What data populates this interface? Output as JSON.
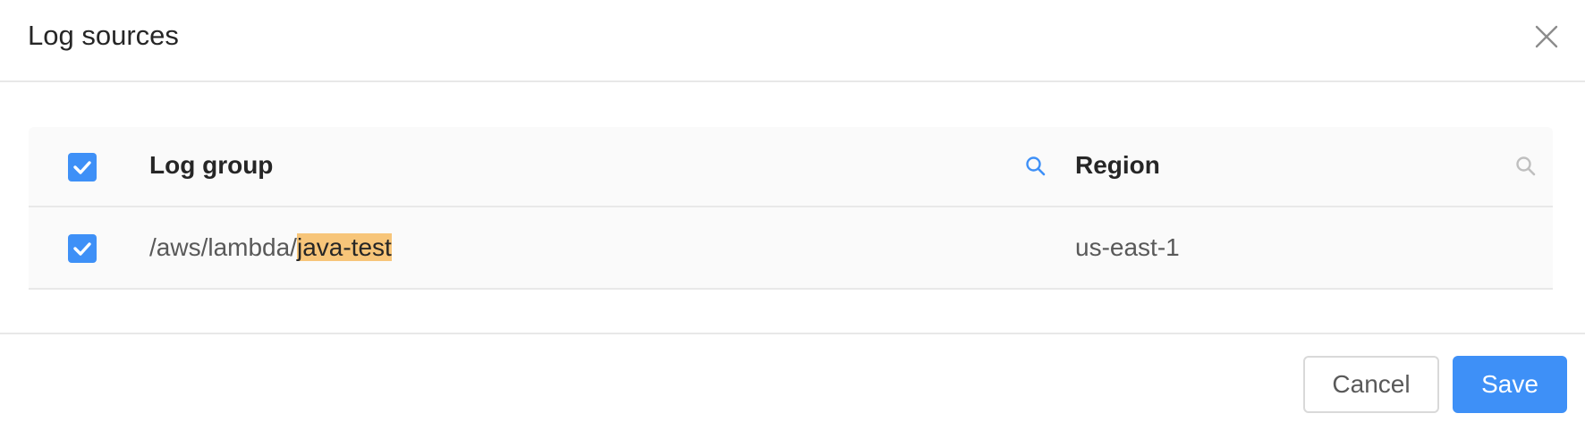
{
  "modal": {
    "title": "Log sources"
  },
  "table": {
    "columns": {
      "log_group": "Log group",
      "region": "Region"
    },
    "header_checkbox_checked": true,
    "rows": [
      {
        "checked": true,
        "log_group_prefix": "/aws/lambda/",
        "log_group_match": "java-test",
        "region": "us-east-1"
      }
    ]
  },
  "footer": {
    "cancel_label": "Cancel",
    "save_label": "Save"
  },
  "colors": {
    "accent": "#3e90f7",
    "highlight": "#f7c579",
    "active_search_icon": "#3e90f7",
    "inactive_search_icon": "#bfbfbf"
  },
  "icons": {
    "close": "close-icon",
    "search": "search-icon",
    "check": "check-icon"
  }
}
